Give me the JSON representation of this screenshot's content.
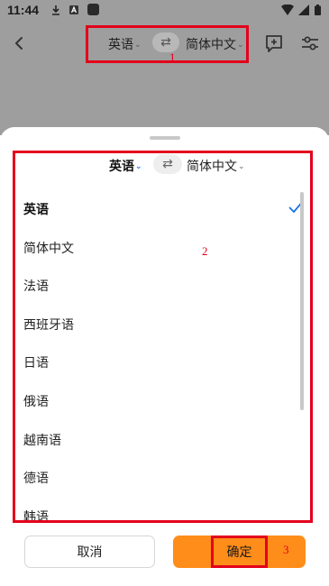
{
  "status_bar": {
    "time": "11:44"
  },
  "toolbar": {
    "source_lang": "英语",
    "target_lang": "简体中文",
    "swap_glyph": "⇄",
    "marker": "1"
  },
  "sheet": {
    "source_lang": "英语",
    "target_lang": "简体中文",
    "swap_glyph": "⇄",
    "languages": [
      {
        "label": "英语",
        "selected": true
      },
      {
        "label": "简体中文",
        "selected": false
      },
      {
        "label": "法语",
        "selected": false
      },
      {
        "label": "西班牙语",
        "selected": false
      },
      {
        "label": "日语",
        "selected": false
      },
      {
        "label": "俄语",
        "selected": false
      },
      {
        "label": "越南语",
        "selected": false
      },
      {
        "label": "德语",
        "selected": false
      },
      {
        "label": "韩语",
        "selected": false
      }
    ],
    "marker": "2"
  },
  "buttons": {
    "cancel_label": "取消",
    "confirm_label": "确定",
    "marker": "3"
  },
  "colors": {
    "accent": "#ff8d1a",
    "check": "#1a73e8",
    "annotation": "#e3001b"
  },
  "icons": {
    "back": "back-arrow-icon",
    "feedback": "feedback-add-icon",
    "settings": "settings-sliders-icon",
    "check": "checkmark-icon"
  }
}
